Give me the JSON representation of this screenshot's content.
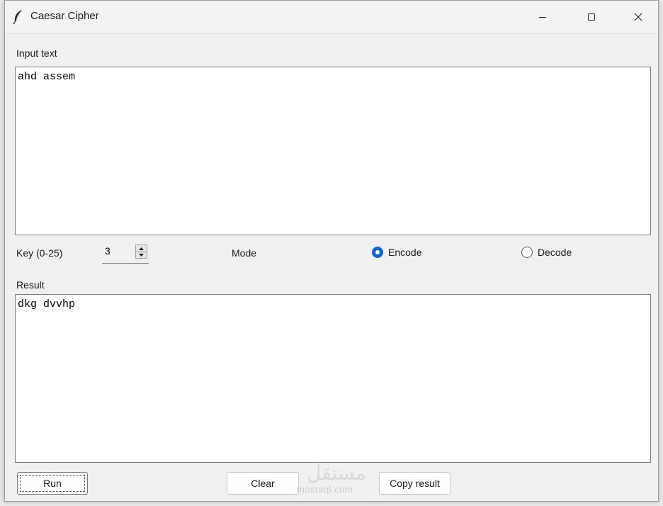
{
  "window": {
    "title": "Caesar Cipher",
    "controls": {
      "minimize": "minimize-icon",
      "maximize": "maximize-icon",
      "close": "close-icon"
    }
  },
  "input": {
    "label": "Input text",
    "value": "ahd assem"
  },
  "key": {
    "label": "Key (0-25)",
    "value": "3"
  },
  "mode": {
    "label": "Mode",
    "options": [
      {
        "label": "Encode",
        "selected": true
      },
      {
        "label": "Decode",
        "selected": false
      }
    ]
  },
  "result": {
    "label": "Result",
    "value": "dkg dvvhp"
  },
  "buttons": {
    "run": "Run",
    "clear": "Clear",
    "copy": "Copy result"
  },
  "watermark": {
    "text": "mostaql.com",
    "arabic": "مستقل"
  },
  "colors": {
    "accent": "#0f66c8",
    "window_bg": "#f0f0f0"
  }
}
